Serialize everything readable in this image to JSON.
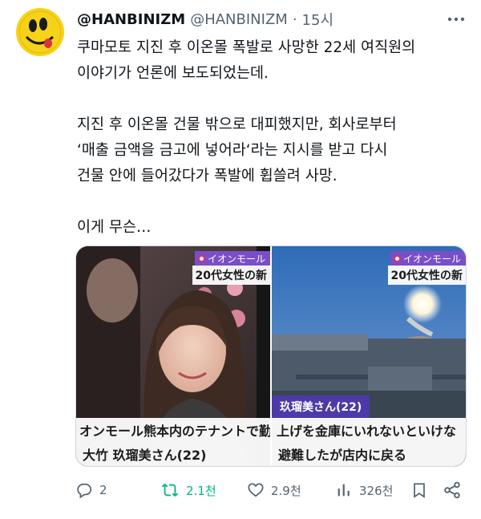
{
  "tweet": {
    "display_name": "@HANBINIZM",
    "handle": "@HANBINIZM",
    "separator": "·",
    "time": "15시",
    "text_lines": [
      "쿠마모토 지진 후 이온몰 폭발로 사망한 22세 여직원의",
      "이야기가 언론에 보도되었는데.",
      "",
      "지진 후 이온몰 건물 밖으로 대피했지만, 회사로부터",
      "‘매출 금액을 금고에 넣어라‘라는 지시를 받고 다시",
      "건물 안에 들어갔다가 폭발에 휩쓸려 사망.",
      "",
      "이게 무슨…"
    ]
  },
  "icons": {
    "avatar": "smiley-face-avatar",
    "more": "more-dots-icon",
    "reply": "reply-icon",
    "retweet": "retweet-icon",
    "like": "heart-icon",
    "views": "views-chart-icon",
    "bookmark": "bookmark-icon",
    "share": "share-icon"
  },
  "media": [
    {
      "news_tag": "イオンモール",
      "headline": "20代女性の新",
      "caption_top": "オンモール熊本内のテナントで勤",
      "caption_bottom": "大竹 玖瑠美さん(22)"
    },
    {
      "news_tag": "イオンモール",
      "headline": "20代女性の新",
      "name_label": "玖瑠美さん(22)",
      "caption_top": "上げを金庫にいれないといけな",
      "caption_bottom": "避難したが店内に戻る"
    }
  ],
  "actions": {
    "replies": "2",
    "retweets": "2.1천",
    "likes": "2.9천",
    "views": "326천"
  },
  "colors": {
    "text": "#0f1419",
    "secondary": "#536471",
    "retweet_active": "#00ba7c",
    "news_purple": "#7a4ec9",
    "avatar_yellow": "#f7d21a"
  }
}
